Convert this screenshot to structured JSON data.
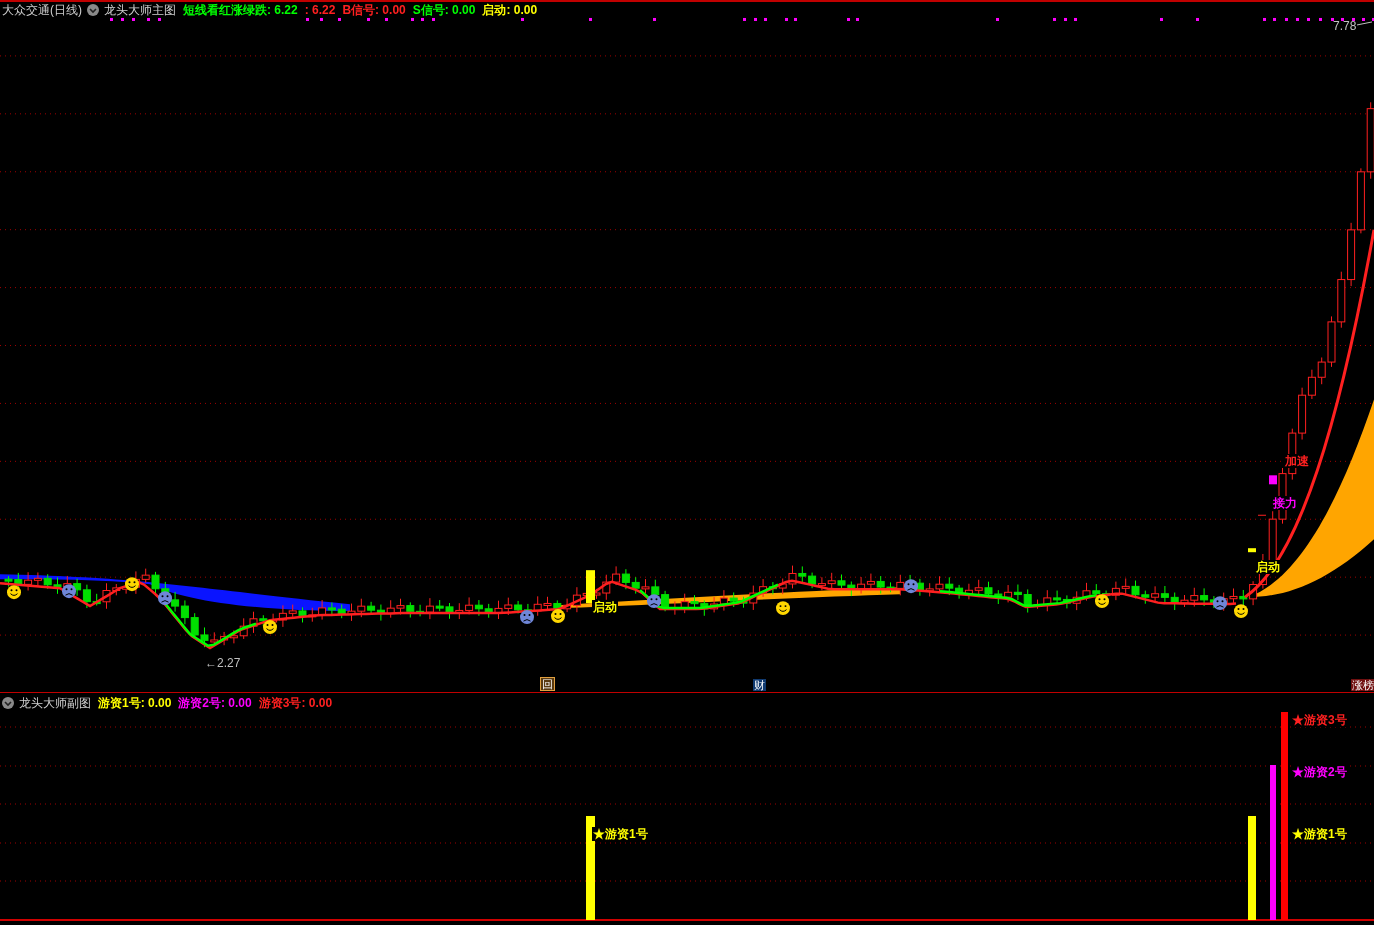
{
  "main_chart": {
    "security": "大众交通(日线)",
    "indicator": "龙头大师主图",
    "legend": [
      {
        "text": "短线看红涨绿跌: 6.22",
        "color": "#00ff00"
      },
      {
        "text": ": 6.22",
        "color": "#ff2020"
      },
      {
        "text": "B信号: 0.00",
        "color": "#ff2020"
      },
      {
        "text": "S信号: 0.00",
        "color": "#00ff00"
      },
      {
        "text": "启动: 0.00",
        "color": "#ffff00"
      }
    ],
    "price_labels": [
      {
        "text": "7.78"
      },
      {
        "text": "←2.27"
      }
    ],
    "annotations": [
      {
        "text": "启动",
        "color": "#ffff00"
      },
      {
        "text": "启动",
        "color": "#ffff00"
      },
      {
        "text": "接力",
        "color": "#ff00ff"
      },
      {
        "text": "加速",
        "color": "#ff2020"
      }
    ],
    "markers": [
      {
        "text": "回",
        "kind": "box"
      },
      {
        "text": "财",
        "kind": "finance"
      },
      {
        "text": "涨榜",
        "kind": "rank"
      }
    ]
  },
  "sub_chart": {
    "indicator": "龙头大师副图",
    "legend": [
      {
        "text": "游资1号: 0.00",
        "color": "#ffff00"
      },
      {
        "text": "游资2号: 0.00",
        "color": "#ff00ff"
      },
      {
        "text": "游资3号: 0.00",
        "color": "#ff2020"
      }
    ],
    "bar_labels": [
      {
        "text": "★游资3号",
        "color": "#ff2020"
      },
      {
        "text": "★游资2号",
        "color": "#ff00ff"
      },
      {
        "text": "★游资1号",
        "color": "#ffff00"
      },
      {
        "text": "★游资1号",
        "color": "#ffff00"
      }
    ]
  }
}
